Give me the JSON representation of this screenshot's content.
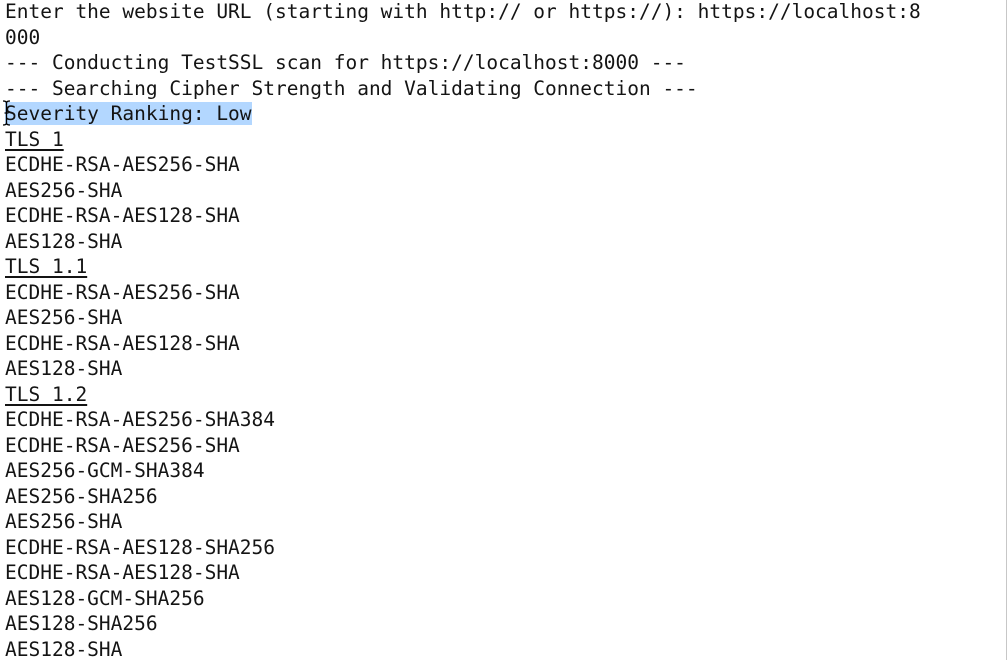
{
  "terminal": {
    "prompt": {
      "line1": "Enter the website URL (starting with http:// or https://): https://localhost:8",
      "line2": "000"
    },
    "status": {
      "scan": "--- Conducting TestSSL scan for https://localhost:8000 ---",
      "cipher": "--- Searching Cipher Strength and Validating Connection ---"
    },
    "severity": "Severity Ranking: Low",
    "sections": [
      {
        "header": "TLS 1",
        "ciphers": [
          "ECDHE-RSA-AES256-SHA",
          "AES256-SHA",
          "ECDHE-RSA-AES128-SHA",
          "AES128-SHA"
        ]
      },
      {
        "header": "TLS 1.1",
        "ciphers": [
          "ECDHE-RSA-AES256-SHA",
          "AES256-SHA",
          "ECDHE-RSA-AES128-SHA",
          "AES128-SHA"
        ]
      },
      {
        "header": "TLS 1.2",
        "ciphers": [
          "ECDHE-RSA-AES256-SHA384",
          "ECDHE-RSA-AES256-SHA",
          "AES256-GCM-SHA384",
          "AES256-SHA256",
          "AES256-SHA",
          "ECDHE-RSA-AES128-SHA256",
          "ECDHE-RSA-AES128-SHA",
          "AES128-GCM-SHA256",
          "AES128-SHA256",
          "AES128-SHA"
        ]
      }
    ],
    "colors": {
      "text": "#141414",
      "selection": "#b3d7ff",
      "background": "#ffffff"
    },
    "cursor_icon": "ibeam-cursor-icon"
  }
}
